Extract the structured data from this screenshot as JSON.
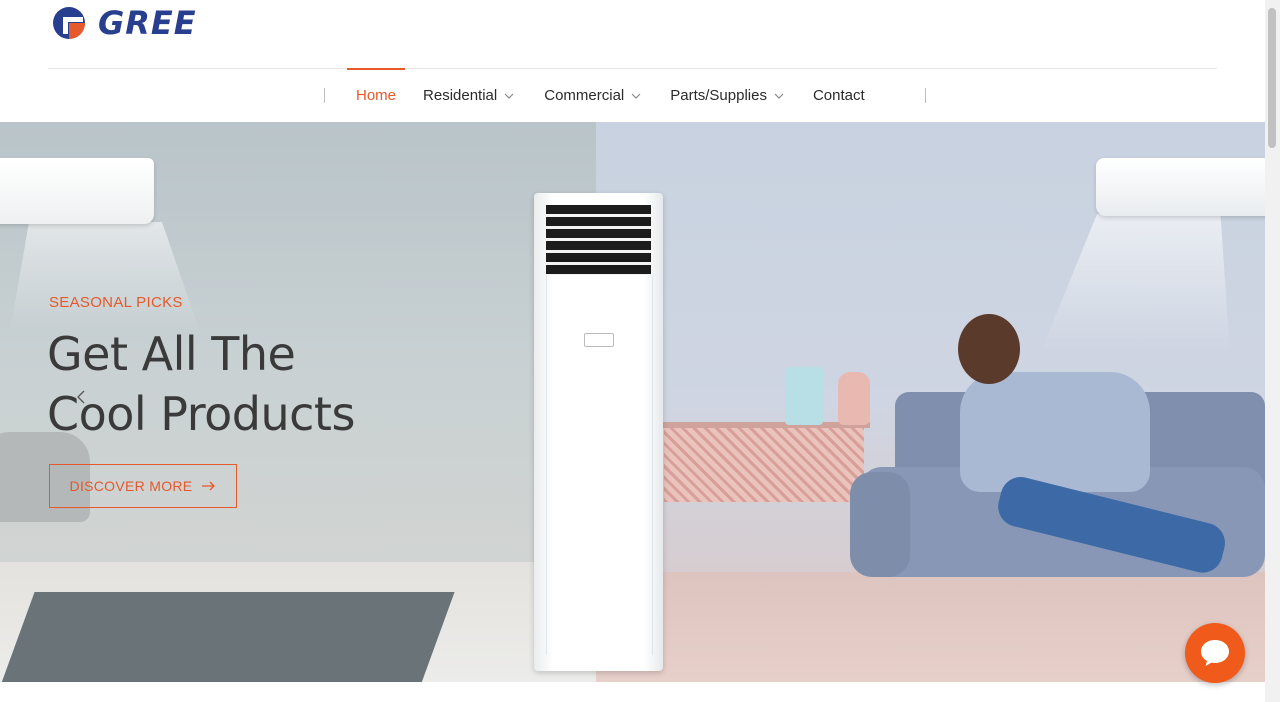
{
  "brand": {
    "name": "GREE",
    "logo_icon": "gree-circle-logo-icon",
    "colors": {
      "blue": "#283e8f",
      "orange": "#e5592b"
    }
  },
  "nav": {
    "items": [
      {
        "label": "Home",
        "active": true,
        "has_dropdown": false
      },
      {
        "label": "Residential",
        "active": false,
        "has_dropdown": true
      },
      {
        "label": "Commercial",
        "active": false,
        "has_dropdown": true
      },
      {
        "label": "Parts/Supplies",
        "active": false,
        "has_dropdown": true
      },
      {
        "label": "Contact",
        "active": false,
        "has_dropdown": false
      }
    ]
  },
  "hero": {
    "eyebrow": "SEASONAL PICKS",
    "headline_line1": "Get All The",
    "headline_line2": "Cool Products",
    "cta_label": "DISCOVER MORE",
    "cta_icon": "arrow-right-icon",
    "prev_icon": "chevron-left-icon"
  },
  "chat": {
    "icon": "chat-bubble-icon"
  },
  "theme": {
    "accent": "#e5592b",
    "chat_button": "#f05a1a"
  }
}
